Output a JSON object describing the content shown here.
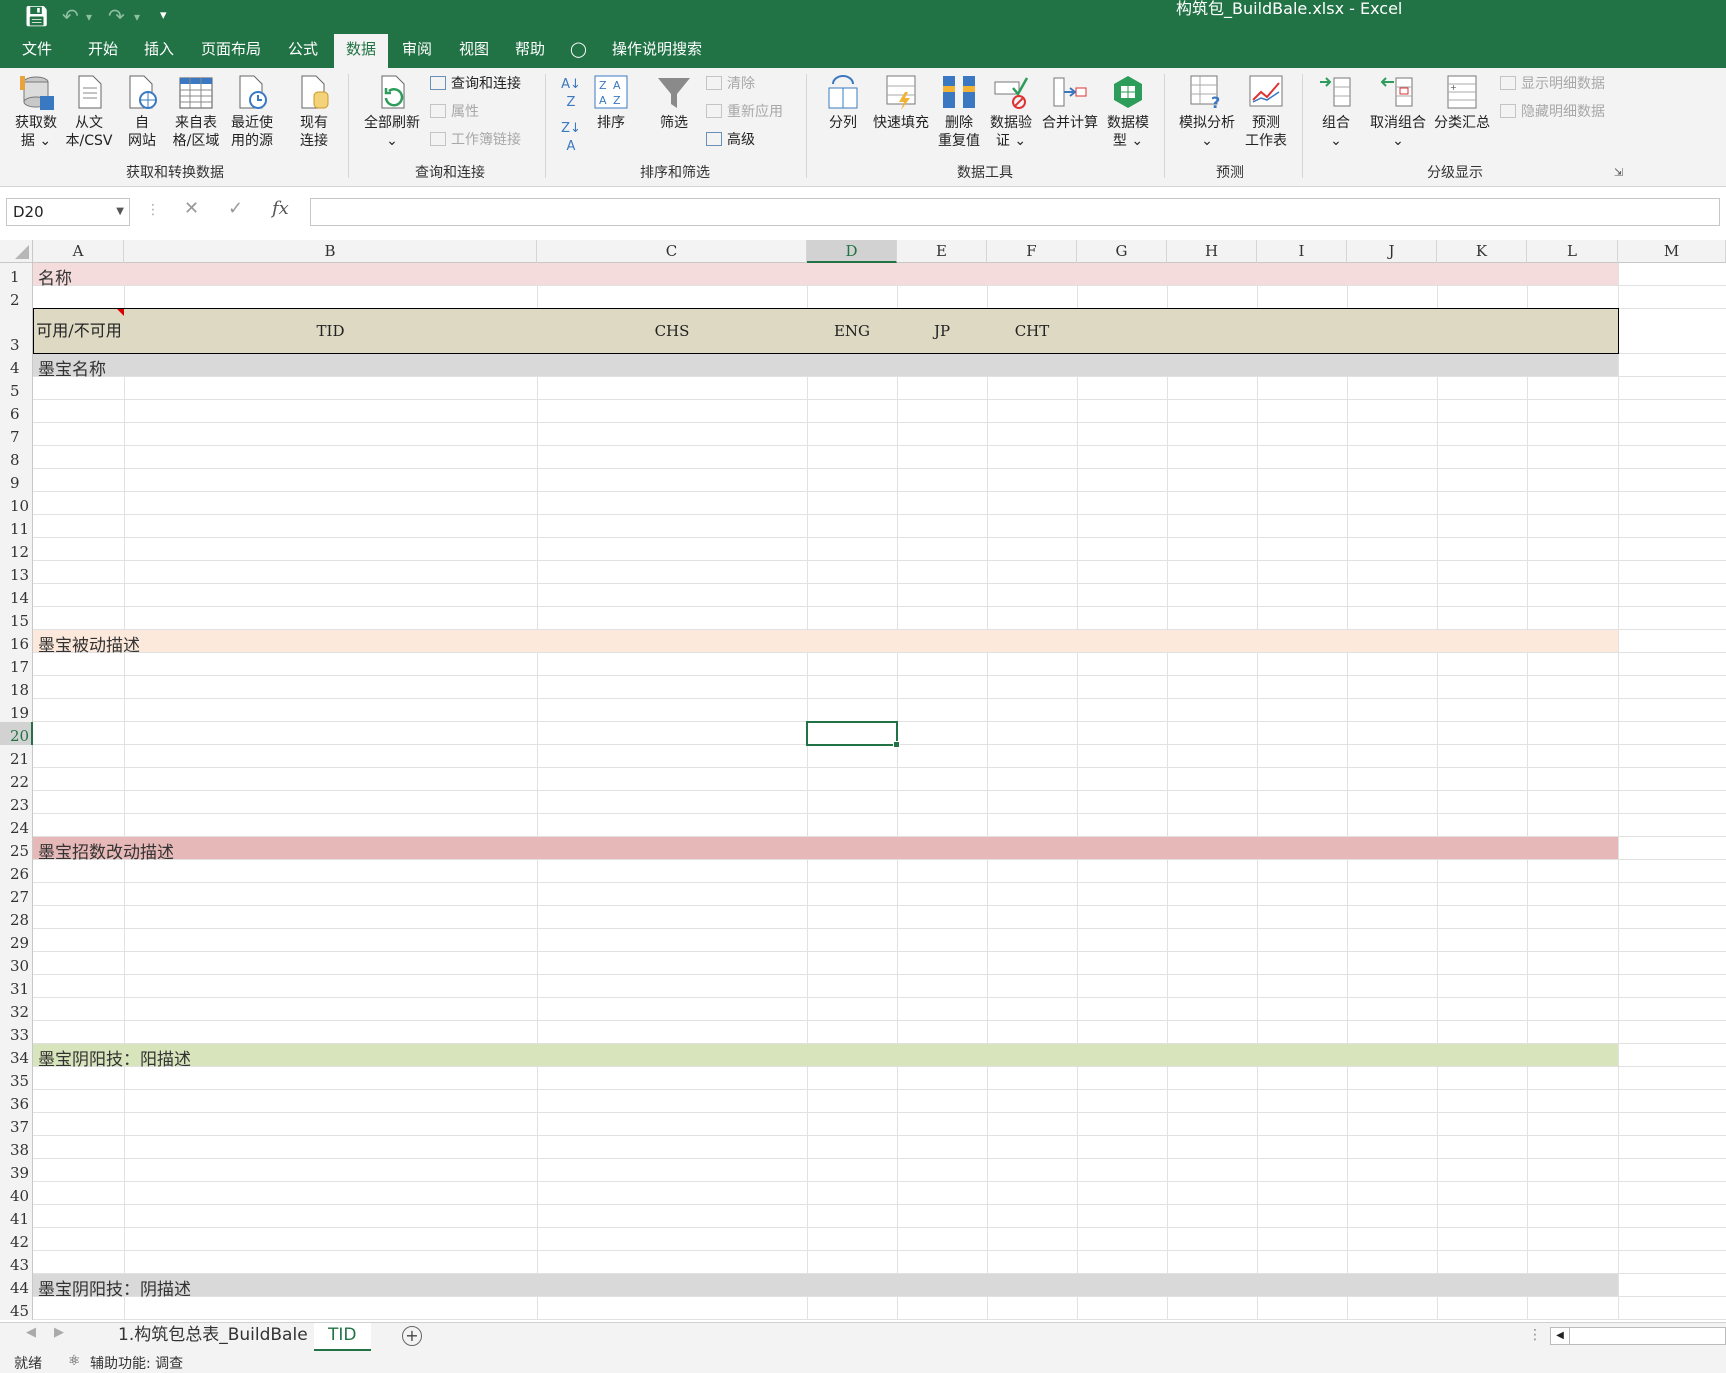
{
  "window": {
    "title": "构筑包_BuildBale.xlsx  -  Excel"
  },
  "menu": {
    "tabs": [
      "文件",
      "开始",
      "插入",
      "页面布局",
      "公式",
      "数据",
      "审阅",
      "视图",
      "帮助"
    ],
    "active": "数据",
    "tell_me": "操作说明搜索"
  },
  "ribbon": {
    "get_transform": {
      "label": "获取和转换数据",
      "get_data": [
        "获取数",
        "据 ⌄"
      ],
      "from_csv": [
        "从文",
        "本/CSV"
      ],
      "from_web": [
        "自",
        "网站"
      ],
      "from_table": [
        "来自表",
        "格/区域"
      ],
      "recent": [
        "最近使",
        "用的源"
      ],
      "existing": [
        "现有",
        "连接"
      ]
    },
    "queries": {
      "label": "查询和连接",
      "refresh_all": [
        "全部刷新",
        "⌄"
      ],
      "queries_connections": "查询和连接",
      "properties": "属性",
      "edit_links": "工作簿链接"
    },
    "sort_filter": {
      "label": "排序和筛选",
      "sort": "排序",
      "filter": "筛选",
      "clear": "清除",
      "reapply": "重新应用",
      "advanced": "高级"
    },
    "data_tools": {
      "label": "数据工具",
      "text_to_columns": "分列",
      "flash_fill": "快速填充",
      "remove_duplicates": [
        "删除",
        "重复值"
      ],
      "data_validation": [
        "数据验",
        "证 ⌄"
      ],
      "consolidate": "合并计算",
      "data_model": [
        "数据模",
        "型 ⌄"
      ]
    },
    "forecast": {
      "label": "预测",
      "what_if": [
        "模拟分析",
        "⌄"
      ],
      "forecast_sheet": [
        "预测",
        "工作表"
      ]
    },
    "outline": {
      "label": "分级显示",
      "group": [
        "组合",
        "⌄"
      ],
      "ungroup": [
        "取消组合",
        "⌄"
      ],
      "subtotal": "分类汇总",
      "show_detail": "显示明细数据",
      "hide_detail": "隐藏明细数据"
    }
  },
  "formula_bar": {
    "name_box": "D20",
    "cancel": "✕",
    "enter": "✓",
    "fx": "fx",
    "formula": ""
  },
  "columns": [
    "A",
    "B",
    "C",
    "D",
    "E",
    "F",
    "G",
    "H",
    "I",
    "J",
    "K",
    "L",
    "M"
  ],
  "selected_column": "D",
  "selected_row": 20,
  "rows": [
    "1",
    "2",
    "3",
    "4",
    "5",
    "6",
    "7",
    "8",
    "9",
    "10",
    "11",
    "12",
    "13",
    "14",
    "15",
    "16",
    "17",
    "18",
    "19",
    "20",
    "21",
    "22",
    "23",
    "24",
    "25",
    "26",
    "27",
    "28",
    "29",
    "30",
    "31",
    "32",
    "33",
    "34",
    "35",
    "36",
    "37",
    "38",
    "39",
    "40",
    "41",
    "42",
    "43",
    "44",
    "45"
  ],
  "cells": {
    "r1": "名称",
    "header": [
      "可用/不可用",
      "TID",
      "CHS",
      "ENG",
      "JP",
      "CHT",
      "",
      "",
      "",
      "",
      "",
      ""
    ],
    "r4": "墨宝名称",
    "r16": "墨宝被动描述",
    "r25": "墨宝招数改动描述",
    "r34": "墨宝阴阳技：阳描述",
    "r44": "墨宝阴阳技：阴描述"
  },
  "band_colors": {
    "r1": "#f4dcdc",
    "r4": "#d9d9d9",
    "r16": "#fce9dc",
    "r25": "#e6b8b7",
    "r34": "#d8e4bc",
    "r44": "#d9d9d9",
    "header": "#ddd9c3"
  },
  "sheets": {
    "tabs": [
      "1.构筑包总表_BuildBale",
      "TID"
    ],
    "active": "TID"
  },
  "status": {
    "ready": "就绪",
    "accessibility": "辅助功能: 调查"
  }
}
